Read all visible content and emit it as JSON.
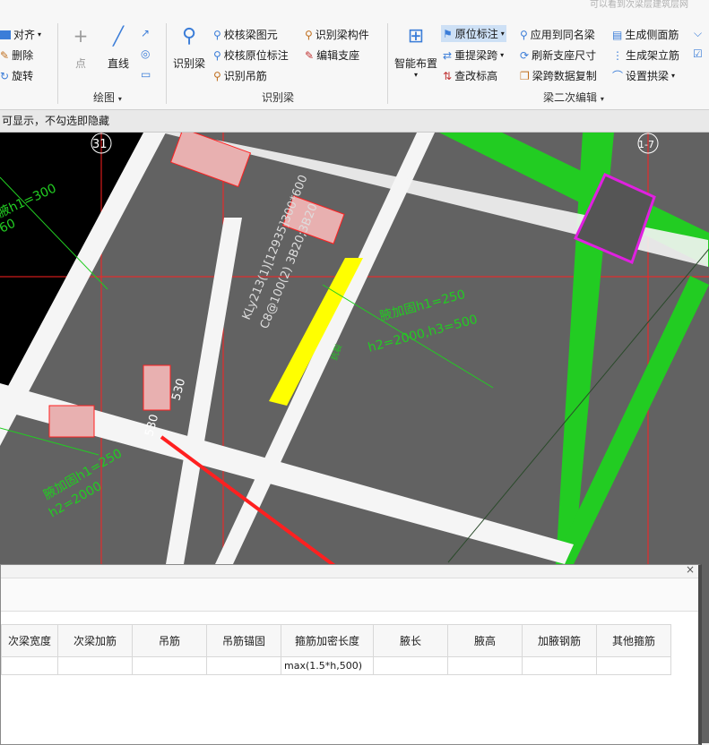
{
  "watermark": "可以看到次梁层建筑层网",
  "ribbon": {
    "align": "对齐",
    "delete": "删除",
    "rotate": "旋转",
    "point": "点",
    "line": "直线",
    "draw_group": "绘图",
    "identify_beam": "识别梁",
    "check_beam_elem": "校核梁图元",
    "check_orig_mark": "校核原位标注",
    "identify_hanger": "识别吊筋",
    "identify_beam_comp": "识别梁构件",
    "edit_support": "编辑支座",
    "identify_group": "识别梁",
    "smart_layout": "智能布置",
    "orig_mark": "原位标注",
    "re_span": "重提梁跨",
    "check_elev": "查改标高",
    "apply_same": "应用到同名梁",
    "refresh_support": "刷新支座尺寸",
    "copy_span": "梁跨数据复制",
    "gen_side": "生成侧面筋",
    "gen_stand": "生成架立筋",
    "set_arch": "设置拱梁",
    "edit_group": "梁二次编辑"
  },
  "status": "可显示，不勾选即隐藏",
  "cad": {
    "axis_31": "31",
    "axis_17": "1-7",
    "beam_mark_1": "KLy213(1)[12935]300*600",
    "beam_mark_2": "C8@100(2) 3B20;3B20",
    "haunch_1": "腋加固h1=250",
    "haunch_2": "h2=2000,h3=500",
    "haunch_3": "腋加固h1=250",
    "haunch_4": "h2=2000",
    "haunch_5": "腋h1=300",
    "haunch_6": "60",
    "dim_530a": "530",
    "dim_530b": "530",
    "small": "抗裂",
    "colors": {
      "bg": "#626262",
      "green": "#22cc22",
      "yellow": "#ffff00",
      "magenta": "#e020e0",
      "red": "#ff2020"
    }
  },
  "panel": {
    "close": "×",
    "columns": [
      "次梁宽度",
      "次梁加筋",
      "吊筋",
      "吊筋锚固",
      "箍筋加密长度",
      "腋长",
      "腋高",
      "加腋钢筋",
      "其他箍筋"
    ],
    "row": [
      "",
      "",
      "",
      "",
      "max(1.5*h,500)",
      "",
      "",
      "",
      ""
    ]
  }
}
